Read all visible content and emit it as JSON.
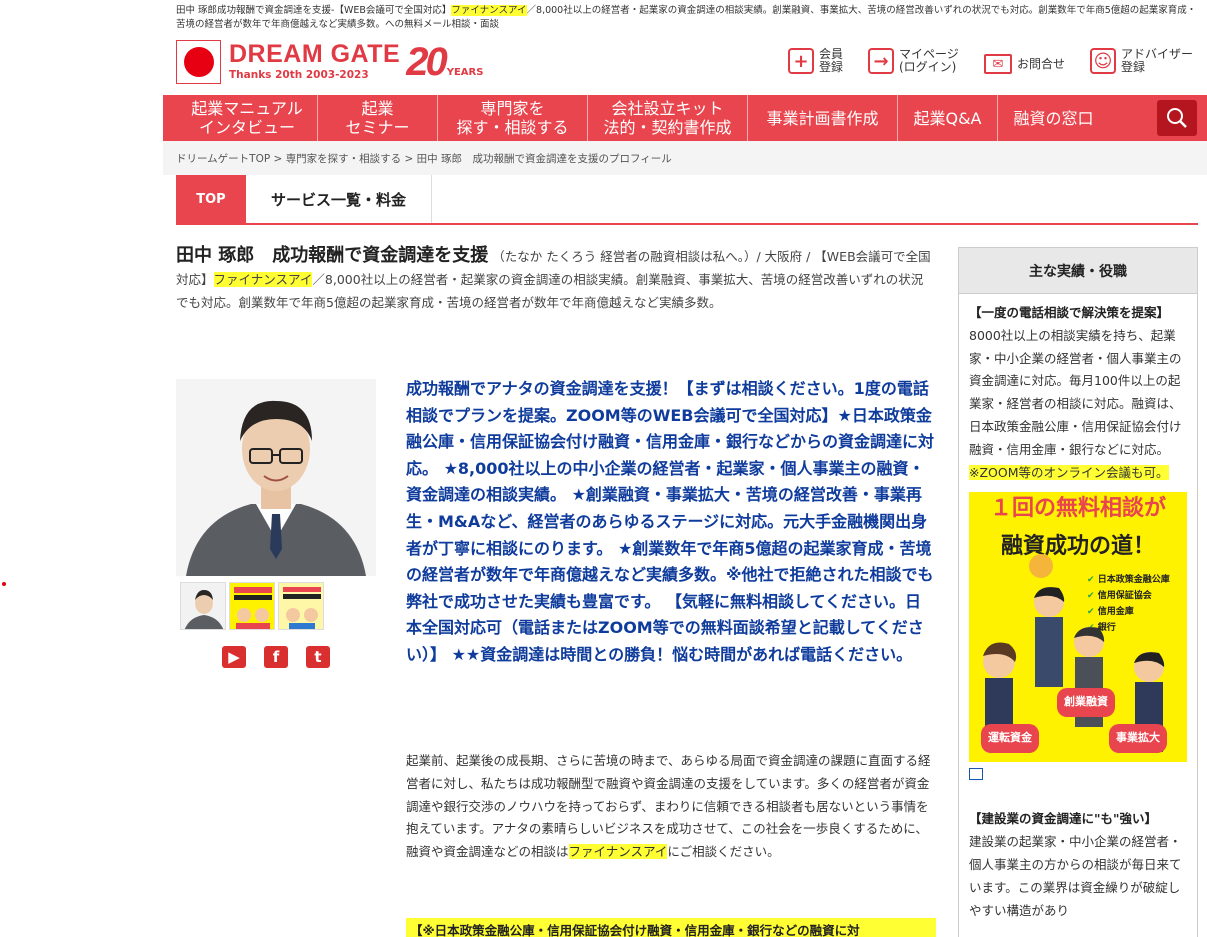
{
  "top_description": {
    "text1": "田中 琢郎成功報酬で資金調達を支援-【WEB会議可で全国対応】",
    "highlight": "ファイナンスアイ",
    "text2": "／8,000社以上の経営者・起業家の資金調達の相談実績。創業融資、事業拡大、苦境の経営改善いずれの状況でも対応。創業数年で年商5億超の起業家育成・苦境の経営者が数年で年商億越えなど実績多数。への無料メール相談・面談"
  },
  "logo": {
    "main": "DREAM GATE",
    "sub": "Thanks 20th 2003-2023",
    "twenty": "20",
    "years": "YEARS"
  },
  "header_nav": [
    {
      "icon": "plus-icon",
      "label1": "会員",
      "label2": "登録"
    },
    {
      "icon": "login-icon",
      "label1": "マイページ",
      "label2": "(ログイン)"
    },
    {
      "icon": "mail-icon",
      "label1": "お問合せ",
      "label2": ""
    },
    {
      "icon": "advisor-icon",
      "label1": "アドバイザー",
      "label2": "登録"
    }
  ],
  "global_nav": [
    {
      "line1": "起業マニュアル",
      "line2": "インタビュー"
    },
    {
      "line1": "起業",
      "line2": "セミナー"
    },
    {
      "line1": "専門家を",
      "line2": "探す・相談する"
    },
    {
      "line1": "会社設立キット",
      "line2": "法的・契約書作成"
    },
    {
      "line1": "事業計画書作成",
      "line2": ""
    },
    {
      "line1": "起業Q&A",
      "line2": ""
    },
    {
      "line1": "融資の窓口",
      "line2": ""
    }
  ],
  "breadcrumb": {
    "item1": "ドリームゲートTOP",
    "sep": " > ",
    "item2": "専門家を探す・相談する",
    "item3": "田中 琢郎　成功報酬で資金調達を支援のプロフィール"
  },
  "tabs": {
    "top": "TOP",
    "services": "サービス一覧・料金"
  },
  "profile": {
    "name": "田中 琢郎　成功報酬で資金調達を支援",
    "reading": "（たなか たくろう 経営者の融資相談は私へ。）/ 大阪府",
    "desc_prefix": "/ 【WEB会議可で全国対応】",
    "desc_highlight": "ファイナンスアイ",
    "desc_rest": "／8,000社以上の経営者・起業家の資金調達の相談実績。創業融資、事業拡大、苦境の経営改善いずれの状況でも対応。創業数年で年商5億超の起業家育成・苦境の経営者が数年で年商億越えなど実績多数。"
  },
  "lead": "成功報酬でアナタの資金調達を支援！【まずは相談ください。1度の電話相談でプランを提案。ZOOM等のWEB会議可で全国対応】★日本政策金融公庫・信用保証協会付け融資・信用金庫・銀行などからの資金調達に対応。 ★8,000社以上の中小企業の経営者・起業家・個人事業主の融資・資金調達の相談実績。 ★創業融資・事業拡大・苦境の経営改善・事業再生・M&Aなど、経営者のあらゆるステージに対応。元大手金融機関出身者が丁寧に相談にのります。 ★創業数年で年商5億超の起業家育成・苦境の経営者が数年で年商億越えなど実績多数。※他社で拒絶された相談でも弊社で成功させた実績も豊富です。 【気軽に無料相談してください。日本全国対応可（電話またはZOOM等での無料面談希望と記載してください）】 ★★資金調達は時間との勝負！悩む時間があれば電話ください。",
  "body": {
    "text": "起業前、起業後の成長期、さらに苦境の時まで、あらゆる局面で資金調達の課題に直面する経営者に対し、私たちは成功報酬型で融資や資金調達の支援をしています。多くの経営者が資金調達や銀行交渉のノウハウを持っておらず、まわりに信頼できる相談者も居ないという事情を抱えています。アナタの素晴らしいビジネスを成功させて、この社会を一歩良くするために、融資や資金調達などの相談は",
    "highlight": "ファイナンスアイ",
    "suffix": "にご相談ください。"
  },
  "highlight_heading": "【※日本政策金融公庫・信用保証協会付け融資・信用金庫・銀行などの融資に対",
  "sidebar": {
    "title": "主な実績・役職",
    "item1_title": "【一度の電話相談で解決策を提案】",
    "item1_text": "8000社以上の相談実績を持ち、起業家・中小企業の経営者・個人事業主の資金調達に対応。毎月100件以上の起業家・経営者の相談に対応。融資は、日本政策金融公庫・信用保証協会付け融資・信用金庫・銀行などに対応。",
    "item1_highlight": "※ZOOM等のオンライン会議も可。",
    "banner": {
      "line1": "１回の無料相談が",
      "line2": "融資成功の道！",
      "list": [
        "日本政策金融公庫",
        "信用保証協会",
        "信用金庫",
        "銀行"
      ],
      "tag1": "創業融資",
      "tag2": "運転資金",
      "tag3": "事業拡大"
    },
    "item2_title": "【建設業の資金調達に\"も\"強い】",
    "item2_text": "建設業の起業家・中小企業の経営者・個人事業主の方からの相談が毎日来ています。この業界は資金繰りが破綻しやすい構造があり"
  }
}
